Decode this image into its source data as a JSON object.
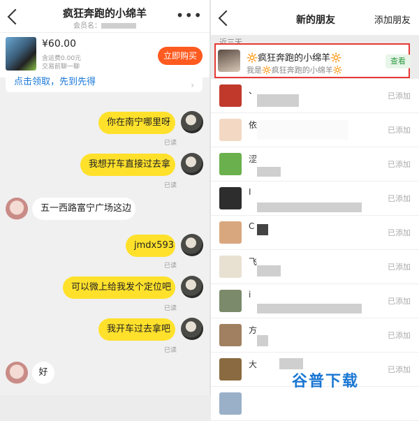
{
  "left": {
    "header": {
      "title": "疯狂奔跑的小绵羊",
      "subtitle": "会员名：",
      "more": "•••"
    },
    "product": {
      "price": "¥60.00",
      "shipping": "含运费0.00元",
      "note": "交易前聊一聊",
      "buy_label": "立即购买"
    },
    "coupon": {
      "text": "点击领取，先到先得",
      "arrow": "›"
    },
    "messages": [
      {
        "from": "me",
        "text": "你在南宁哪里呀",
        "status": "已读"
      },
      {
        "from": "me",
        "text": "我想开车直接过去拿",
        "status": "已读"
      },
      {
        "from": "other",
        "text": "五一西路富宁广场这边"
      },
      {
        "from": "me",
        "text": "jmdx593",
        "status": "已读"
      },
      {
        "from": "me",
        "text": "可以微上给我发个定位吧",
        "status": "已读"
      },
      {
        "from": "me",
        "text": "我开车过去拿吧",
        "status": "已读"
      },
      {
        "from": "other",
        "text": "好"
      }
    ]
  },
  "right": {
    "header": {
      "title": "新的朋友",
      "add_label": "添加朋友"
    },
    "section_label": "近三天",
    "highlight": {
      "name": "🔆疯狂奔跑的小绵羊🔆",
      "message": "我是🔆疯狂奔跑的小绵羊🔆",
      "action": "查看"
    },
    "friends": [
      {
        "name_fragment": "、",
        "status": "已添加",
        "avatar_color": "#c0392b"
      },
      {
        "name_fragment": "依",
        "status": "已添加",
        "avatar_color": "#f3d9c4"
      },
      {
        "name_fragment": "涩",
        "status": "已添加",
        "avatar_color": "#6ab04c"
      },
      {
        "name_fragment": "I",
        "status": "已添加",
        "avatar_color": "#2d2d2d"
      },
      {
        "name_fragment": "C",
        "status": "已添加",
        "avatar_color": "#d9a77e"
      },
      {
        "name_fragment": "飞",
        "status": "已添加",
        "avatar_color": "#e8e1d2"
      },
      {
        "name_fragment": "i",
        "status": "已添加",
        "avatar_color": "#7a8a6a"
      },
      {
        "name_fragment": "方",
        "status": "已添加",
        "avatar_color": "#a08060"
      },
      {
        "name_fragment": "大",
        "status": "已添加",
        "avatar_color": "#8a6a40"
      },
      {
        "name_fragment": "",
        "status": "",
        "avatar_color": "#9ab0c8"
      }
    ]
  },
  "watermark": "谷普下载"
}
